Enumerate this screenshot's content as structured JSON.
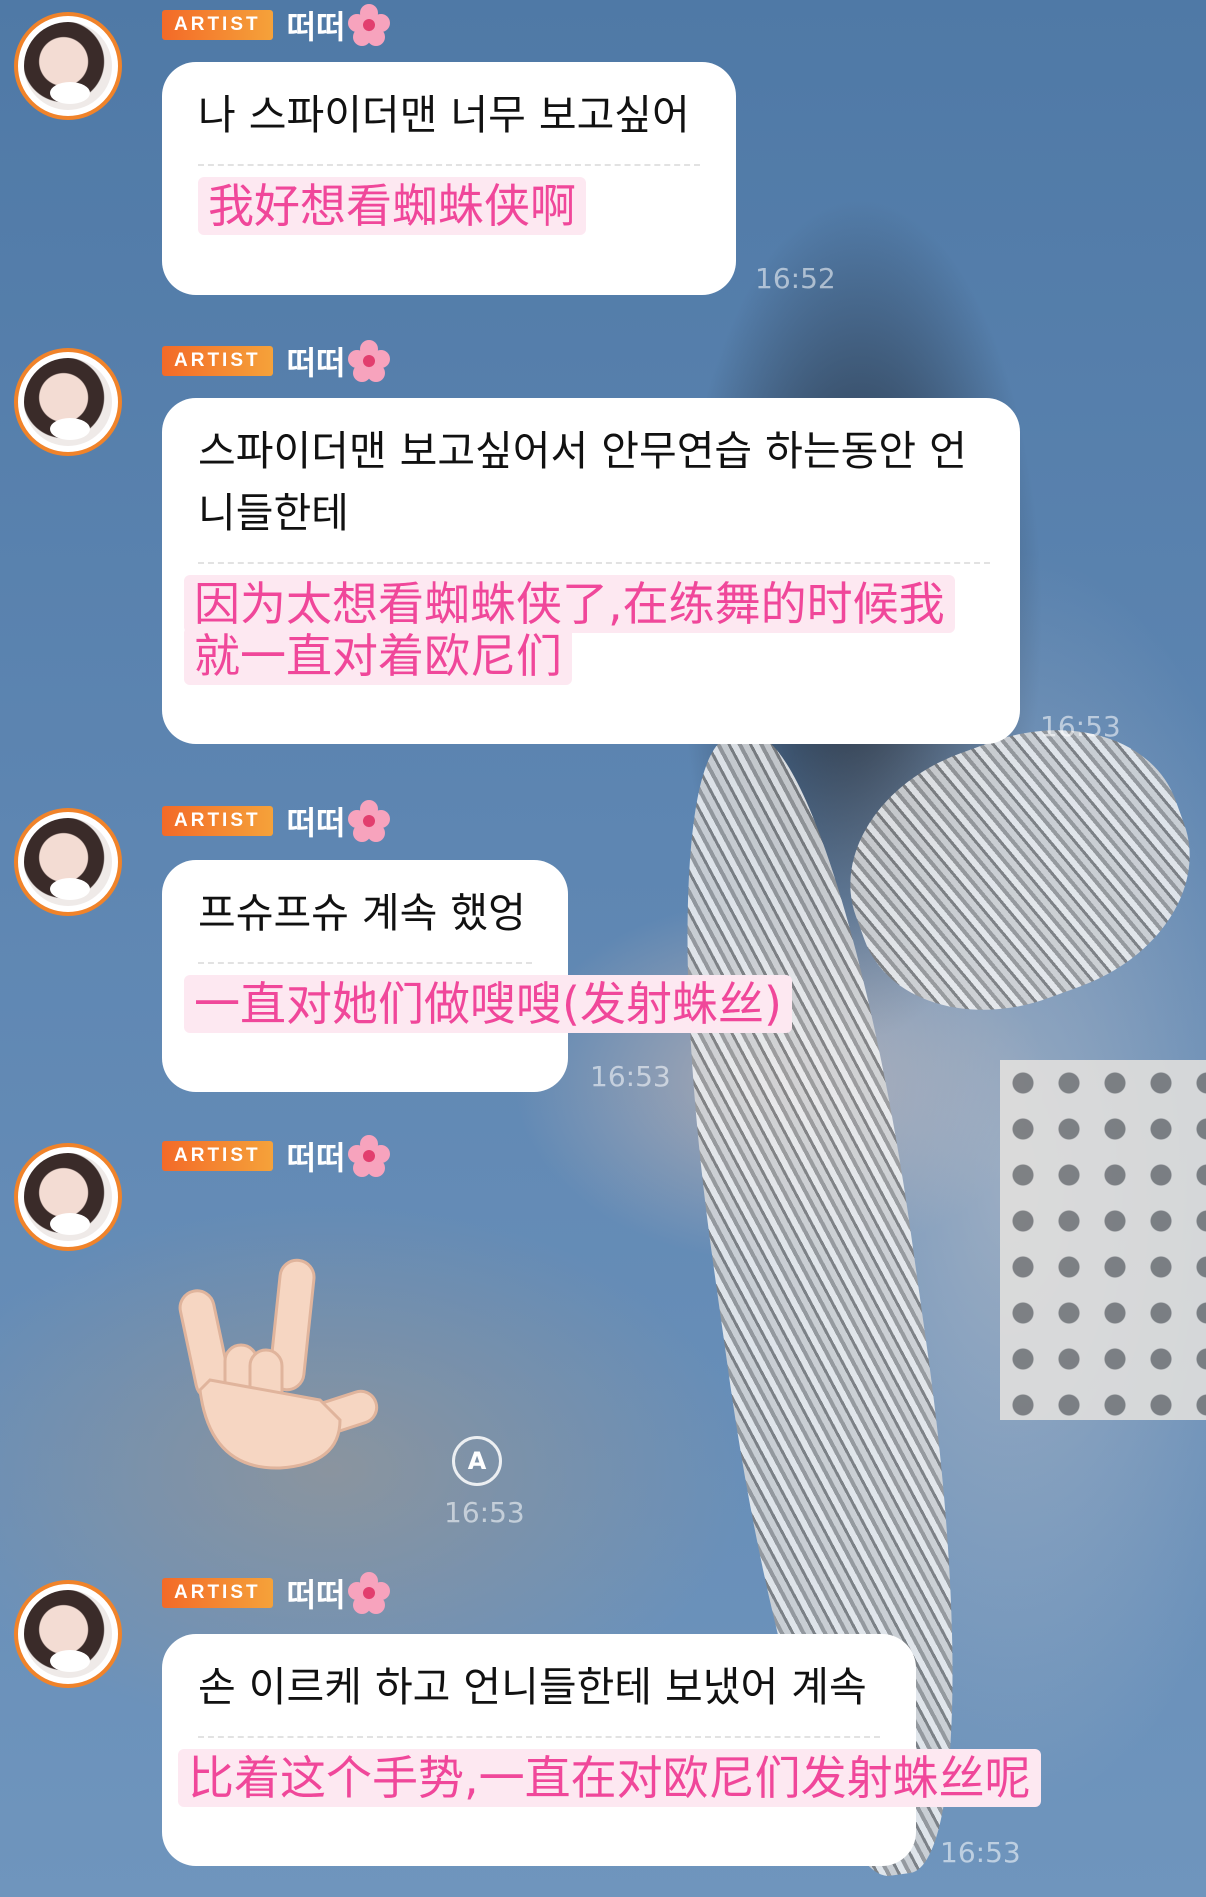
{
  "messages": [
    {
      "badge": "ARTIST",
      "name": "떠떠",
      "korean": "나 스파이더맨 너무 보고싶어",
      "chinese": "我好想看蜘蛛侠啊",
      "time": "16:52"
    },
    {
      "badge": "ARTIST",
      "name": "떠떠",
      "korean": "스파이더맨 보고싶어서 안무연습 하는동안 언니들한테",
      "chinese": "因为太想看蜘蛛侠了,在练舞的时候我就一直对着欧尼们",
      "time": "16:53"
    },
    {
      "badge": "ARTIST",
      "name": "떠떠",
      "korean": "프슈프슈 계속 했엉",
      "chinese": "一直对她们做嗖嗖(发射蛛丝)",
      "time": "16:53"
    },
    {
      "badge": "ARTIST",
      "name": "떠떠",
      "emoji": "love-you-gesture",
      "time": "16:53"
    },
    {
      "badge": "ARTIST",
      "name": "떠떠",
      "korean": "손 이르케 하고 언니들한테 보냈어 계속",
      "chinese": "比着这个手势,一直在对欧尼们发射蛛丝呢",
      "time": "16:53"
    }
  ],
  "translate_button": "A",
  "colors": {
    "badge": "#f36a28",
    "avatar_ring": "#f0832a",
    "chinese_text": "#f0479a",
    "chinese_highlight": "#fde8f1"
  }
}
